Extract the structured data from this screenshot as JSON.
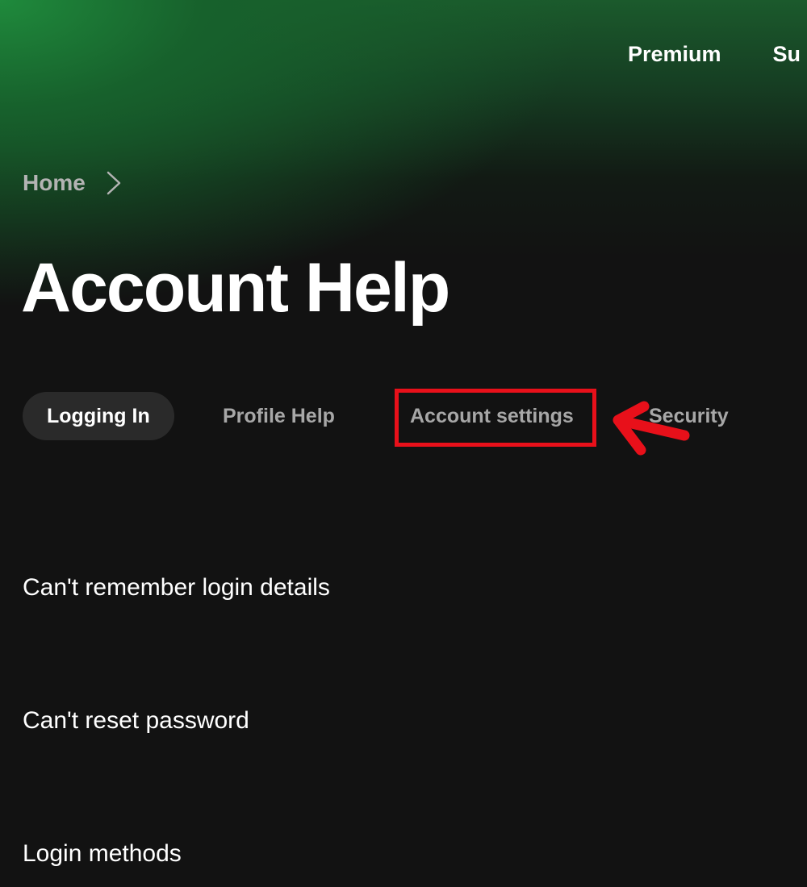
{
  "top_nav": {
    "items": [
      "Premium",
      "Su"
    ]
  },
  "breadcrumb": {
    "items": [
      "Home"
    ],
    "separator_icon": "chevron-right-icon"
  },
  "page": {
    "title": "Account Help"
  },
  "tabs": {
    "items": [
      {
        "label": "Logging In",
        "active": true
      },
      {
        "label": "Profile Help",
        "active": false
      },
      {
        "label": "Account settings",
        "active": false,
        "highlighted": true
      },
      {
        "label": "Security",
        "active": false
      }
    ]
  },
  "questions": {
    "items": [
      "Can't remember login details",
      "Can't reset password",
      "Login methods"
    ]
  },
  "annotation": {
    "type": "red-box-with-arrow",
    "target": "Account settings",
    "color": "#e8101a"
  },
  "colors": {
    "background": "#121212",
    "hero_green": "#1f8a3c",
    "active_tab_bg": "#2a2a2a",
    "inactive_text": "#a7a7a7",
    "annotation_red": "#e8101a"
  }
}
